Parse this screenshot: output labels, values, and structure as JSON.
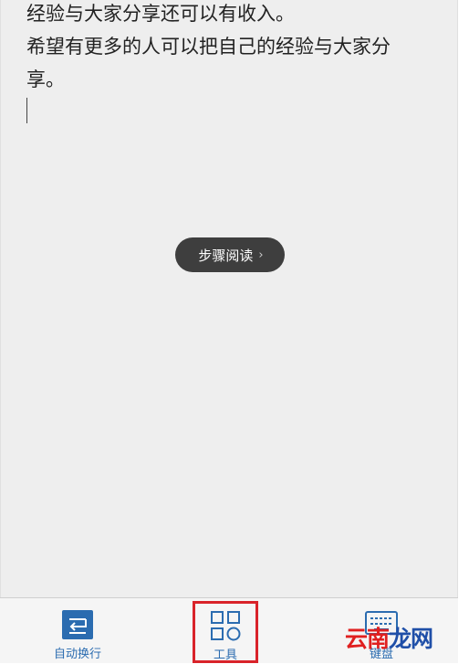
{
  "editor": {
    "lines": [
      "经验与大家分享还可以有收入。",
      "希望有更多的人可以把自己的经验与大家分",
      "享。"
    ]
  },
  "step_reading": {
    "label": "步骤阅读",
    "chevron": "›"
  },
  "toolbar": {
    "wrap_label": "自动换行",
    "tools_label": "工具",
    "keyboard_label": "键盘"
  },
  "watermark": {
    "part1": "云南",
    "part2": "龙网"
  },
  "colors": {
    "accent": "#2b6cb0",
    "highlight_box": "#d9232a",
    "pill_bg": "#3e3e3e"
  },
  "icons": {
    "wrap": "wrap-text-icon",
    "tools": "tools-grid-icon",
    "keyboard": "keyboard-icon"
  }
}
